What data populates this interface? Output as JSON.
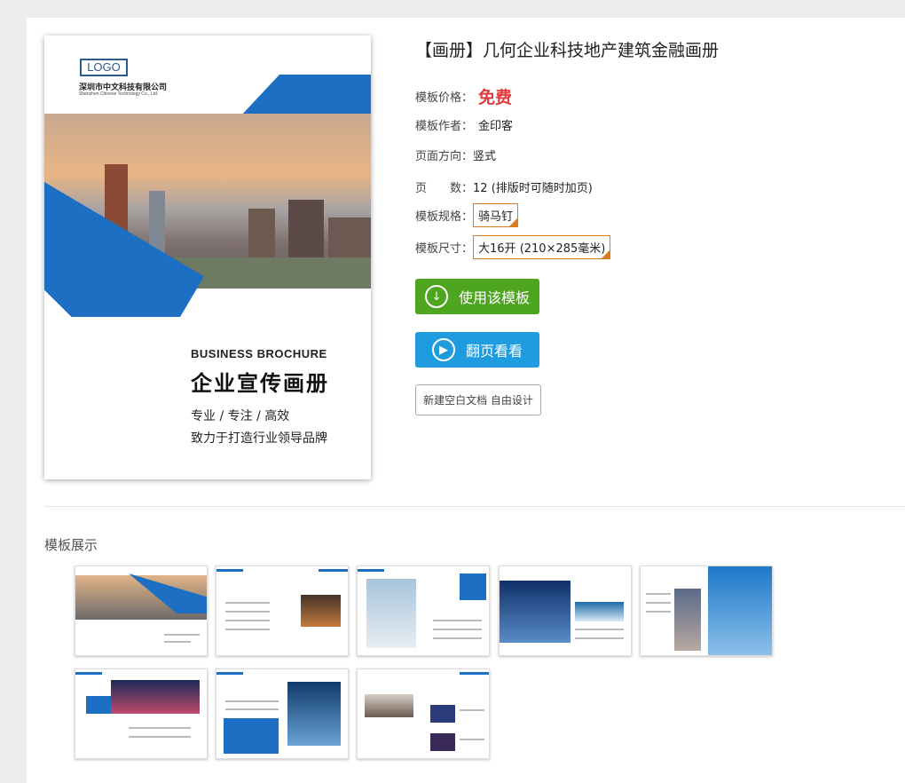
{
  "cover": {
    "logo": "LOGO",
    "company_cn": "深圳市中文科技有限公司",
    "company_en": "Shenzhen Chinese Technology Co., Ltd.",
    "heading_en": "BUSINESS  BROCHURE",
    "heading_cn": "企业宣传画册",
    "tagline1": "专业 / 专注 / 高效",
    "tagline2": "致力于打造行业领导品牌"
  },
  "product": {
    "title": "【画册】几何企业科技地产建筑金融画册",
    "price_label": "模板价格：",
    "price_value": "免费",
    "author_label": "模板作者：",
    "author_value": "金印客",
    "orientation_label": "页面方向：",
    "orientation_value": "竖式",
    "pages_label": "页　　数：",
    "pages_value": "12 (排版时可随时加页)",
    "spec_label": "模板规格：",
    "spec_value": "骑马钉",
    "size_label": "模板尺寸：",
    "size_value": "大16开 (210×285毫米)"
  },
  "buttons": {
    "use": "使用该模板",
    "flip": "翻页看看",
    "blank": "新建空白文档 自由设计"
  },
  "showcase": {
    "title": "模板展示"
  },
  "colors": {
    "accent": "#1c6fc2",
    "green": "#4ea520",
    "blue": "#1f9be0",
    "price": "#e23b3b",
    "tag": "#d87a1d"
  }
}
